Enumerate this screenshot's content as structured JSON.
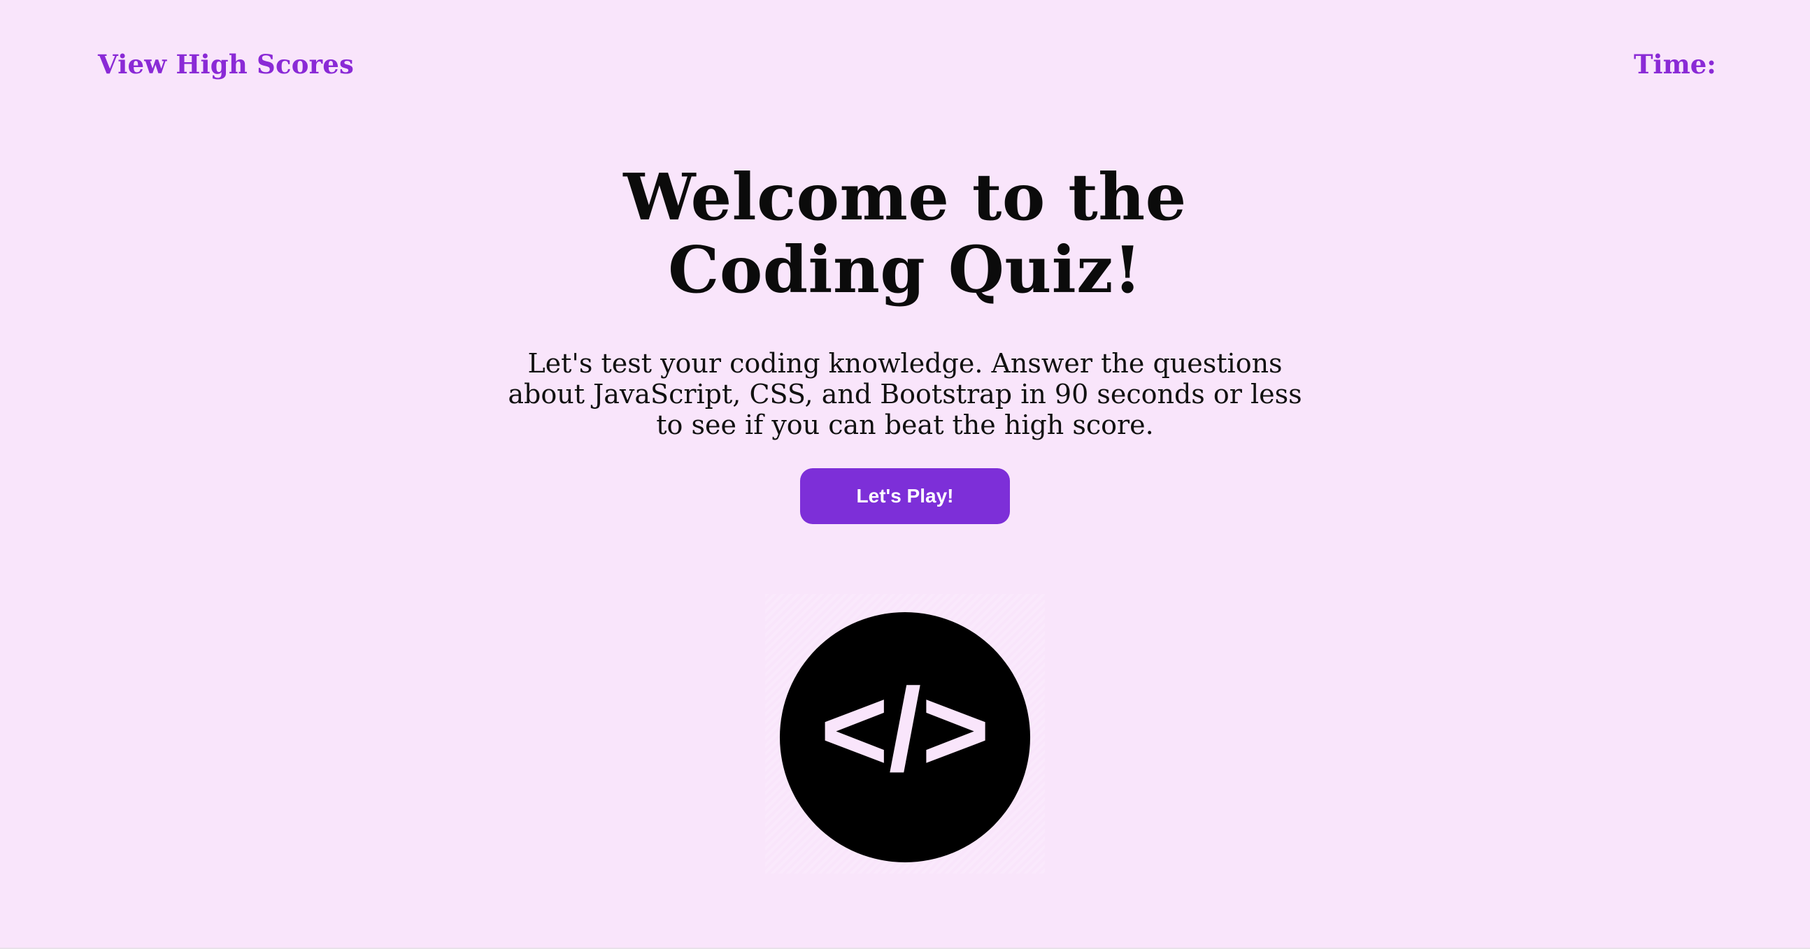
{
  "header": {
    "high_scores_link": "View High Scores",
    "time_label": "Time:",
    "time_value": ""
  },
  "main": {
    "title": "Welcome to the Coding Quiz!",
    "description": "Let's test your coding knowledge. Answer the questions about JavaScript, CSS, and Bootstrap in 90 seconds or less to see if you can beat the high score.",
    "start_button": "Let's Play!"
  },
  "logo": {
    "icon": "code-tag-icon",
    "glyph": "</>"
  },
  "colors": {
    "background": "#f9e5fb",
    "accent": "#8a2ad6",
    "button": "#7d2fd8",
    "text": "#0b0b0b"
  }
}
